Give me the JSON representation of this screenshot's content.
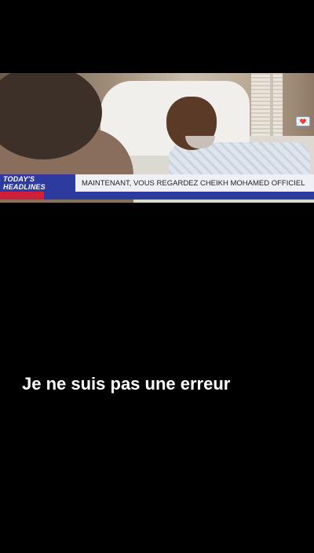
{
  "video": {
    "ticker_label": "TODAY'S HEADLINES",
    "ticker_text": "MAINTENANT, VOUS REGARDEZ CHEIKH MOHAMED OFFICIEL"
  },
  "caption": {
    "text": "Je ne suis pas une erreur"
  },
  "colors": {
    "ticker_label_bg": "#2d3a9e",
    "ticker_accent_red": "#d01f3a",
    "page_bg": "#000000"
  }
}
